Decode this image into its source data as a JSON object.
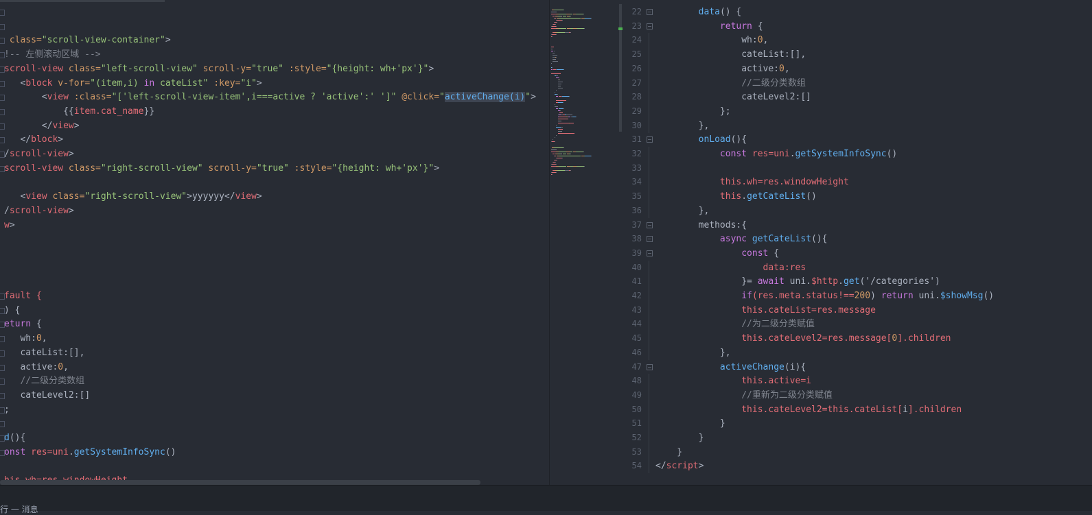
{
  "left_editor": {
    "lines": [
      [
        {
          "t": "",
          "c": "plain"
        }
      ],
      [
        {
          "t": "",
          "c": "plain"
        }
      ],
      [
        {
          "t": " class=",
          "c": "attr"
        },
        {
          "t": "\"scroll-view-container\"",
          "c": "str"
        },
        {
          "t": ">",
          "c": "plain"
        }
      ],
      [
        {
          "t": "!-- 左侧滚动区域 -->",
          "c": "com"
        }
      ],
      [
        {
          "t": "scroll-view",
          "c": "tag"
        },
        {
          "t": " class=",
          "c": "attr"
        },
        {
          "t": "\"left-scroll-view\"",
          "c": "str"
        },
        {
          "t": " scroll-y=",
          "c": "attr"
        },
        {
          "t": "\"true\"",
          "c": "str"
        },
        {
          "t": " :style=",
          "c": "attr"
        },
        {
          "t": "\"{height: wh+",
          "c": "str"
        },
        {
          "t": "'px'",
          "c": "str"
        },
        {
          "t": "}\"",
          "c": "str"
        },
        {
          "t": ">",
          "c": "plain"
        }
      ],
      [
        {
          "t": "   <",
          "c": "plain"
        },
        {
          "t": "block",
          "c": "tag"
        },
        {
          "t": " v-for=",
          "c": "attr"
        },
        {
          "t": "\"(item,i) ",
          "c": "str"
        },
        {
          "t": "in",
          "c": "kw"
        },
        {
          "t": " cateList\"",
          "c": "str"
        },
        {
          "t": " :key=",
          "c": "attr"
        },
        {
          "t": "\"i\"",
          "c": "str"
        },
        {
          "t": ">",
          "c": "plain"
        }
      ],
      [
        {
          "t": "       <",
          "c": "plain"
        },
        {
          "t": "view",
          "c": "tag"
        },
        {
          "t": " :class=",
          "c": "attr"
        },
        {
          "t": "\"[",
          "c": "str"
        },
        {
          "t": "'left-scroll-view-item'",
          "c": "str"
        },
        {
          "t": ",i===active ? ",
          "c": "str"
        },
        {
          "t": "'active'",
          "c": "str"
        },
        {
          "t": ":' ']\"",
          "c": "str"
        },
        {
          "t": " @click=",
          "c": "attr"
        },
        {
          "t": "\"",
          "c": "str"
        },
        {
          "t": "activeChange(i)",
          "c": "hl"
        },
        {
          "t": "\"",
          "c": "str"
        },
        {
          "t": ">",
          "c": "plain"
        }
      ],
      [
        {
          "t": "           {{",
          "c": "plain"
        },
        {
          "t": "item.cat_name",
          "c": "var"
        },
        {
          "t": "}}",
          "c": "plain"
        }
      ],
      [
        {
          "t": "       </",
          "c": "plain"
        },
        {
          "t": "view",
          "c": "tag"
        },
        {
          "t": ">",
          "c": "plain"
        }
      ],
      [
        {
          "t": "   </",
          "c": "plain"
        },
        {
          "t": "block",
          "c": "tag"
        },
        {
          "t": ">",
          "c": "plain"
        }
      ],
      [
        {
          "t": "/",
          "c": "plain"
        },
        {
          "t": "scroll-view",
          "c": "tag"
        },
        {
          "t": ">",
          "c": "plain"
        }
      ],
      [
        {
          "t": "scroll-view",
          "c": "tag"
        },
        {
          "t": " class=",
          "c": "attr"
        },
        {
          "t": "\"right-scroll-view\"",
          "c": "str"
        },
        {
          "t": " scroll-y=",
          "c": "attr"
        },
        {
          "t": "\"true\"",
          "c": "str"
        },
        {
          "t": " :style=",
          "c": "attr"
        },
        {
          "t": "\"{height: wh+",
          "c": "str"
        },
        {
          "t": "'px'",
          "c": "str"
        },
        {
          "t": "}\"",
          "c": "str"
        },
        {
          "t": ">",
          "c": "plain"
        }
      ],
      [
        {
          "t": "",
          "c": "plain"
        }
      ],
      [
        {
          "t": "   <",
          "c": "plain"
        },
        {
          "t": "view",
          "c": "tag"
        },
        {
          "t": " class=",
          "c": "attr"
        },
        {
          "t": "\"right-scroll-view\"",
          "c": "str"
        },
        {
          "t": ">yyyyyy</",
          "c": "plain"
        },
        {
          "t": "view",
          "c": "tag"
        },
        {
          "t": ">",
          "c": "plain"
        }
      ],
      [
        {
          "t": "/",
          "c": "plain"
        },
        {
          "t": "scroll-view",
          "c": "tag"
        },
        {
          "t": ">",
          "c": "plain"
        }
      ],
      [
        {
          "t": "w",
          "c": "tag"
        },
        {
          "t": ">",
          "c": "plain"
        }
      ],
      [
        {
          "t": "",
          "c": "plain"
        }
      ],
      [
        {
          "t": "",
          "c": "plain"
        }
      ],
      [
        {
          "t": "",
          "c": "plain"
        }
      ],
      [
        {
          "t": "",
          "c": "plain"
        }
      ],
      [
        {
          "t": "fault {",
          "c": "var"
        }
      ],
      [
        {
          "t": ") {",
          "c": "plain"
        }
      ],
      [
        {
          "t": "eturn",
          "c": "kw"
        },
        {
          "t": " {",
          "c": "plain"
        }
      ],
      [
        {
          "t": "   wh:",
          "c": "plain"
        },
        {
          "t": "0",
          "c": "num"
        },
        {
          "t": ",",
          "c": "plain"
        }
      ],
      [
        {
          "t": "   cateList:[],",
          "c": "plain"
        }
      ],
      [
        {
          "t": "   active:",
          "c": "plain"
        },
        {
          "t": "0",
          "c": "num"
        },
        {
          "t": ",",
          "c": "plain"
        }
      ],
      [
        {
          "t": "   //二级分类数组",
          "c": "com"
        }
      ],
      [
        {
          "t": "   cateLevel2:[]",
          "c": "plain"
        }
      ],
      [
        {
          "t": ";",
          "c": "plain"
        }
      ],
      [
        {
          "t": "",
          "c": "plain"
        }
      ],
      [
        {
          "t": "d",
          "c": "fn"
        },
        {
          "t": "(){",
          "c": "plain"
        }
      ],
      [
        {
          "t": "onst",
          "c": "kw"
        },
        {
          "t": " res=",
          "c": "var"
        },
        {
          "t": "uni",
          "c": "var"
        },
        {
          "t": ".",
          "c": "plain"
        },
        {
          "t": "getSystemInfoSync",
          "c": "fn"
        },
        {
          "t": "()",
          "c": "plain"
        }
      ],
      [
        {
          "t": "",
          "c": "plain"
        }
      ],
      [
        {
          "t": "his.wh=res.windowHeight",
          "c": "var"
        }
      ]
    ]
  },
  "right_editor": {
    "line_numbers": [
      "22",
      "23",
      "24",
      "25",
      "26",
      "27",
      "28",
      "29",
      "30",
      "31",
      "32",
      "33",
      "34",
      "35",
      "36",
      "37",
      "38",
      "39",
      "40",
      "41",
      "42",
      "43",
      "44",
      "45",
      "46",
      "47",
      "48",
      "49",
      "50",
      "51",
      "52",
      "53",
      "54"
    ],
    "lines": [
      [
        {
          "t": "        ",
          "c": "plain"
        },
        {
          "t": "data",
          "c": "fn"
        },
        {
          "t": "() {",
          "c": "plain"
        }
      ],
      [
        {
          "t": "            ",
          "c": "plain"
        },
        {
          "t": "return",
          "c": "kw"
        },
        {
          "t": " {",
          "c": "plain"
        }
      ],
      [
        {
          "t": "                wh:",
          "c": "plain"
        },
        {
          "t": "0",
          "c": "num"
        },
        {
          "t": ",",
          "c": "plain"
        }
      ],
      [
        {
          "t": "                cateList:[],",
          "c": "plain"
        }
      ],
      [
        {
          "t": "                active:",
          "c": "plain"
        },
        {
          "t": "0",
          "c": "num"
        },
        {
          "t": ",",
          "c": "plain"
        }
      ],
      [
        {
          "t": "                //二级分类数组",
          "c": "com"
        }
      ],
      [
        {
          "t": "                cateLevel2:[]",
          "c": "plain"
        }
      ],
      [
        {
          "t": "            };",
          "c": "plain"
        }
      ],
      [
        {
          "t": "        },",
          "c": "plain"
        }
      ],
      [
        {
          "t": "        ",
          "c": "plain"
        },
        {
          "t": "onLoad",
          "c": "fn"
        },
        {
          "t": "(){",
          "c": "plain"
        }
      ],
      [
        {
          "t": "            ",
          "c": "plain"
        },
        {
          "t": "const",
          "c": "kw"
        },
        {
          "t": " res=",
          "c": "var"
        },
        {
          "t": "uni",
          "c": "var"
        },
        {
          "t": ".",
          "c": "plain"
        },
        {
          "t": "getSystemInfoSync",
          "c": "fn"
        },
        {
          "t": "()",
          "c": "plain"
        }
      ],
      [
        {
          "t": "",
          "c": "plain"
        }
      ],
      [
        {
          "t": "            ",
          "c": "plain"
        },
        {
          "t": "this",
          "c": "var"
        },
        {
          "t": ".wh=res.windowHeight",
          "c": "var"
        }
      ],
      [
        {
          "t": "            ",
          "c": "plain"
        },
        {
          "t": "this",
          "c": "var"
        },
        {
          "t": ".",
          "c": "plain"
        },
        {
          "t": "getCateList",
          "c": "fn"
        },
        {
          "t": "()",
          "c": "plain"
        }
      ],
      [
        {
          "t": "        },",
          "c": "plain"
        }
      ],
      [
        {
          "t": "        methods:{",
          "c": "plain"
        }
      ],
      [
        {
          "t": "            ",
          "c": "plain"
        },
        {
          "t": "async",
          "c": "kw"
        },
        {
          "t": " ",
          "c": "plain"
        },
        {
          "t": "getCateList",
          "c": "fn"
        },
        {
          "t": "(){",
          "c": "plain"
        }
      ],
      [
        {
          "t": "                ",
          "c": "plain"
        },
        {
          "t": "const",
          "c": "kw"
        },
        {
          "t": " {",
          "c": "plain"
        }
      ],
      [
        {
          "t": "                    ",
          "c": "plain"
        },
        {
          "t": "data:res",
          "c": "var"
        }
      ],
      [
        {
          "t": "                }= ",
          "c": "plain"
        },
        {
          "t": "await",
          "c": "kw"
        },
        {
          "t": " uni.",
          "c": "plain"
        },
        {
          "t": "$http",
          "c": "var"
        },
        {
          "t": ".",
          "c": "plain"
        },
        {
          "t": "get",
          "c": "fn"
        },
        {
          "t": "('/categories')",
          "c": "plain"
        }
      ],
      [
        {
          "t": "                ",
          "c": "plain"
        },
        {
          "t": "if",
          "c": "kw"
        },
        {
          "t": "(res.meta.status!==",
          "c": "var"
        },
        {
          "t": "200",
          "c": "num"
        },
        {
          "t": ") ",
          "c": "plain"
        },
        {
          "t": "return",
          "c": "kw"
        },
        {
          "t": " uni.",
          "c": "plain"
        },
        {
          "t": "$showMsg",
          "c": "fn"
        },
        {
          "t": "()",
          "c": "plain"
        }
      ],
      [
        {
          "t": "                ",
          "c": "plain"
        },
        {
          "t": "this",
          "c": "var"
        },
        {
          "t": ".cateList=res.message",
          "c": "var"
        }
      ],
      [
        {
          "t": "                //为二级分类赋值",
          "c": "com"
        }
      ],
      [
        {
          "t": "                ",
          "c": "plain"
        },
        {
          "t": "this",
          "c": "var"
        },
        {
          "t": ".cateLevel2=res.message[",
          "c": "var"
        },
        {
          "t": "0",
          "c": "num"
        },
        {
          "t": "].children",
          "c": "var"
        }
      ],
      [
        {
          "t": "            },",
          "c": "plain"
        }
      ],
      [
        {
          "t": "            ",
          "c": "plain"
        },
        {
          "t": "activeChange",
          "c": "fn"
        },
        {
          "t": "(i){",
          "c": "plain"
        }
      ],
      [
        {
          "t": "                ",
          "c": "plain"
        },
        {
          "t": "this",
          "c": "var"
        },
        {
          "t": ".active=i",
          "c": "var"
        }
      ],
      [
        {
          "t": "                //重新为二级分类赋值",
          "c": "com"
        }
      ],
      [
        {
          "t": "                ",
          "c": "plain"
        },
        {
          "t": "this",
          "c": "var"
        },
        {
          "t": ".cateLevel2=",
          "c": "var"
        },
        {
          "t": "this",
          "c": "var"
        },
        {
          "t": ".cateList[",
          "c": "var"
        },
        {
          "t": "i",
          "c": "plain"
        },
        {
          "t": "].children",
          "c": "var"
        }
      ],
      [
        {
          "t": "            }",
          "c": "plain"
        }
      ],
      [
        {
          "t": "        }",
          "c": "plain"
        }
      ],
      [
        {
          "t": "    }",
          "c": "plain"
        }
      ],
      [
        {
          "t": "</",
          "c": "plain"
        },
        {
          "t": "script",
          "c": "tag"
        },
        {
          "t": ">",
          "c": "plain"
        }
      ]
    ],
    "fold_lines": [
      "22",
      "23",
      "31",
      "37",
      "38",
      "39",
      "47"
    ]
  },
  "status_bar": {
    "text": "行 一 消息"
  },
  "colors": {
    "background": "#282c34",
    "status_bar": "#21252b",
    "tag": "#e06c75",
    "string": "#98c379",
    "keyword": "#c678dd",
    "function": "#61afef",
    "number": "#d19a66",
    "comment": "#7f848e",
    "minimap_mark": "#4caf50"
  }
}
